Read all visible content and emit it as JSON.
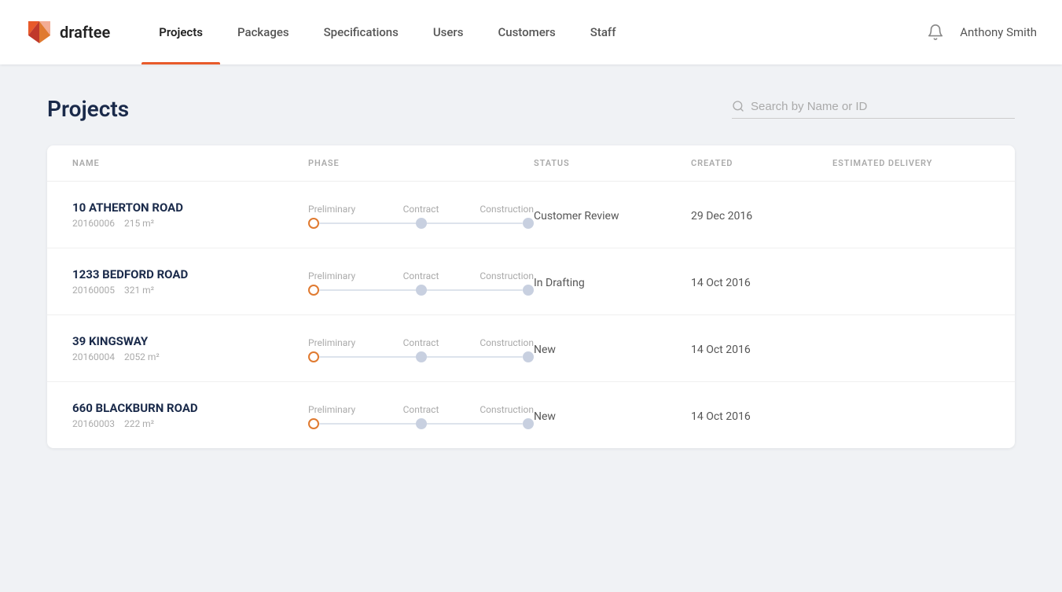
{
  "brand": {
    "name": "draftee"
  },
  "nav": {
    "links": [
      {
        "id": "projects",
        "label": "Projects",
        "active": true
      },
      {
        "id": "packages",
        "label": "Packages",
        "active": false
      },
      {
        "id": "specifications",
        "label": "Specifications",
        "active": false
      },
      {
        "id": "users",
        "label": "Users",
        "active": false
      },
      {
        "id": "customers",
        "label": "Customers",
        "active": false
      },
      {
        "id": "staff",
        "label": "Staff",
        "active": false
      }
    ],
    "user": "Anthony Smith"
  },
  "page": {
    "title": "Projects",
    "search_placeholder": "Search by Name or ID"
  },
  "table": {
    "columns": [
      "NAME",
      "PHASE",
      "STATUS",
      "CREATED",
      "ESTIMATED DELIVERY"
    ],
    "rows": [
      {
        "id": "row-1",
        "name": "10 ATHERTON ROAD",
        "project_id": "20160006",
        "area": "215",
        "status": "Customer Review",
        "created": "29 Dec 2016",
        "estimated_delivery": "",
        "phase_index": 0
      },
      {
        "id": "row-2",
        "name": "1233 BEDFORD ROAD",
        "project_id": "20160005",
        "area": "321",
        "status": "In Drafting",
        "created": "14 Oct 2016",
        "estimated_delivery": "",
        "phase_index": 0
      },
      {
        "id": "row-3",
        "name": "39 KINGSWAY",
        "project_id": "20160004",
        "area": "2052",
        "status": "New",
        "created": "14 Oct 2016",
        "estimated_delivery": "",
        "phase_index": 0
      },
      {
        "id": "row-4",
        "name": "660 BLACKBURN ROAD",
        "project_id": "20160003",
        "area": "222",
        "status": "New",
        "created": "14 Oct 2016",
        "estimated_delivery": "",
        "phase_index": 0
      }
    ]
  }
}
